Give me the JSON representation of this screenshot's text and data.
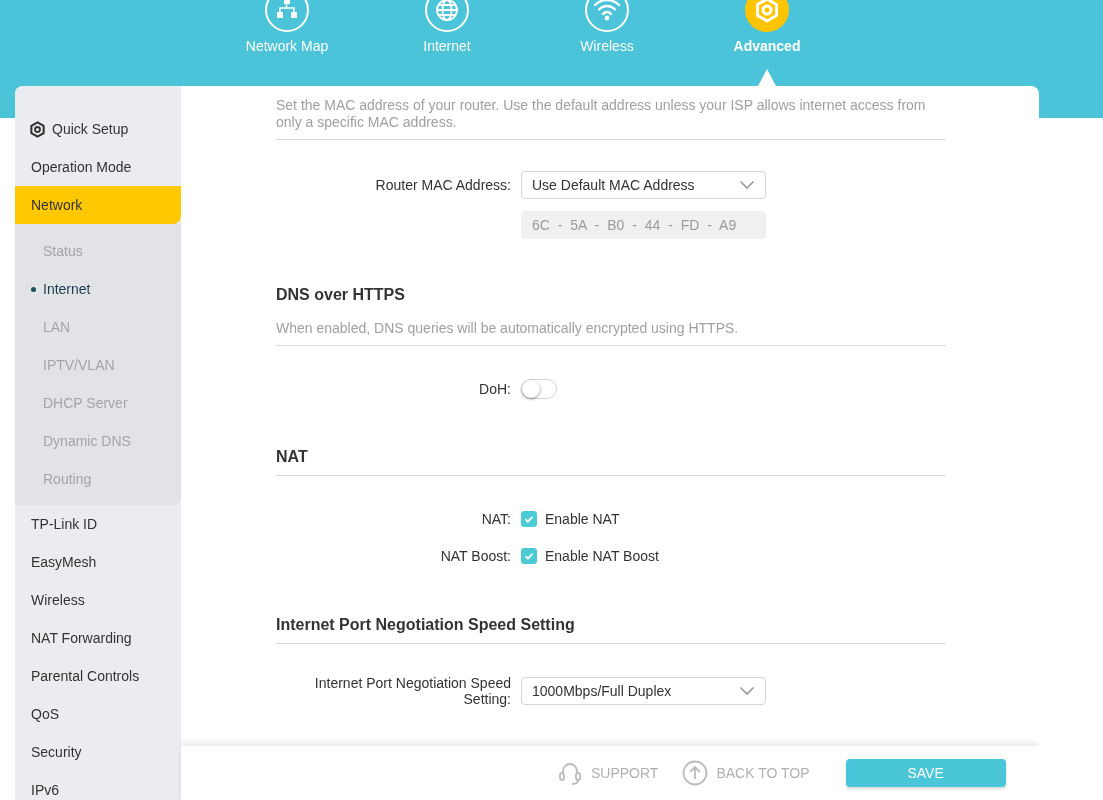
{
  "nav_tabs": [
    {
      "label": "Network Map",
      "kind": "map",
      "selected": false
    },
    {
      "label": "Internet",
      "kind": "globe",
      "selected": false
    },
    {
      "label": "Wireless",
      "kind": "wifi",
      "selected": false
    },
    {
      "label": "Advanced",
      "kind": "gear",
      "selected": true
    }
  ],
  "sidebar": {
    "items": [
      {
        "label": "Quick Setup",
        "kind": "setup",
        "selected": false
      },
      {
        "label": "Operation Mode",
        "kind": "page",
        "selected": false
      },
      {
        "label": "Network",
        "kind": "page",
        "selected": true,
        "expanded": true,
        "children": [
          {
            "label": "Status",
            "selected": false
          },
          {
            "label": "Internet",
            "selected": true
          },
          {
            "label": "LAN",
            "selected": false
          },
          {
            "label": "IPTV/VLAN",
            "selected": false
          },
          {
            "label": "DHCP Server",
            "selected": false
          },
          {
            "label": "Dynamic DNS",
            "selected": false
          },
          {
            "label": "Routing",
            "selected": false
          }
        ]
      },
      {
        "label": "TP-Link ID",
        "kind": "page",
        "selected": false
      },
      {
        "label": "EasyMesh",
        "kind": "page",
        "selected": false
      },
      {
        "label": "Wireless",
        "kind": "page",
        "selected": false
      },
      {
        "label": "NAT Forwarding",
        "kind": "page",
        "selected": false
      },
      {
        "label": "Parental Controls",
        "kind": "page",
        "selected": false
      },
      {
        "label": "QoS",
        "kind": "page",
        "selected": false
      },
      {
        "label": "Security",
        "kind": "page",
        "selected": false
      },
      {
        "label": "IPv6",
        "kind": "page",
        "selected": false
      }
    ]
  },
  "mac_clone": {
    "description": "Set the MAC address of your router. Use the default address unless your ISP allows internet access from only a specific MAC address.",
    "label": "Router MAC Address:",
    "value": "Use Default MAC Address",
    "mac_address": "6C - 5A - B0 - 44 - FD - A9"
  },
  "dns_over_https": {
    "title": "DNS over HTTPS",
    "description": "When enabled, DNS queries will be automatically encrypted using HTTPS.",
    "label": "DoH:",
    "on": false
  },
  "nat": {
    "title": "NAT",
    "rows": [
      {
        "label": "NAT:",
        "text": "Enable NAT",
        "checked": true
      },
      {
        "label": "NAT Boost:",
        "text": "Enable NAT Boost",
        "checked": true
      }
    ]
  },
  "port_speed": {
    "title": "Internet Port Negotiation Speed Setting",
    "label": "Internet Port Negotiation Speed Setting:",
    "value": "1000Mbps/Full Duplex"
  },
  "footer": {
    "support": "SUPPORT",
    "back_to_top": "BACK TO TOP",
    "save": "SAVE"
  }
}
